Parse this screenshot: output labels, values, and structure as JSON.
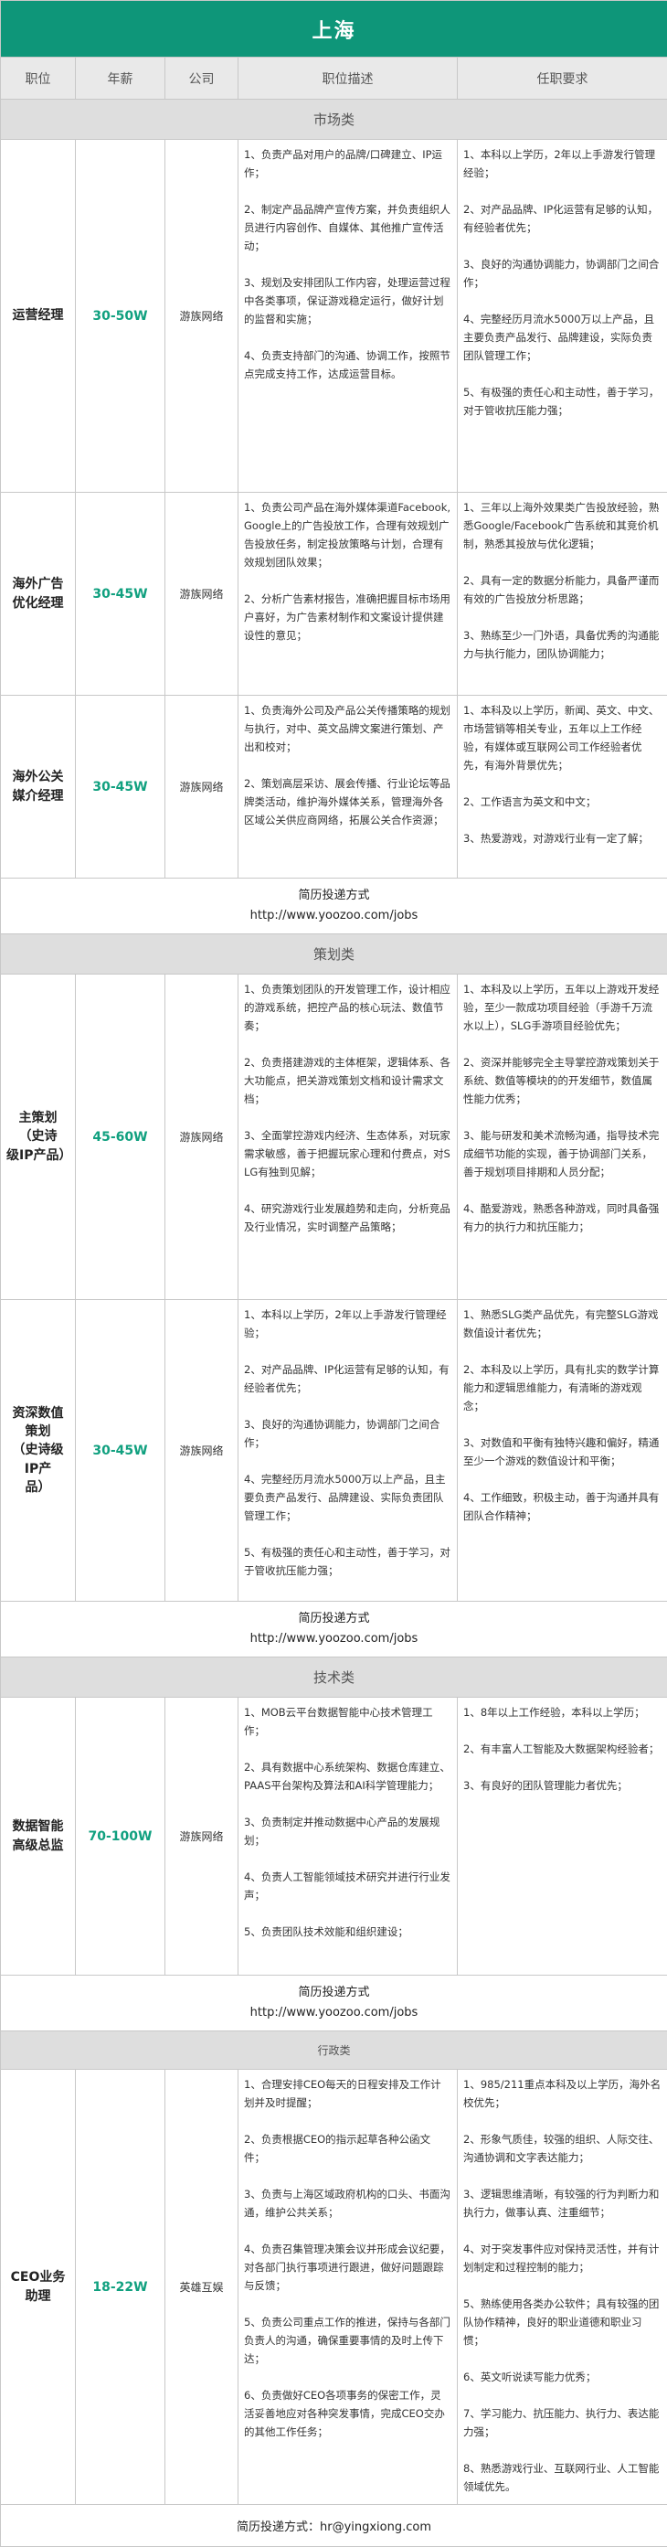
{
  "title": "上海",
  "headers": {
    "position": "职位",
    "salary": "年薪",
    "company": "公司",
    "desc": "职位描述",
    "req": "任职要求"
  },
  "sections": [
    {
      "category": "市场类",
      "jobs": [
        {
          "position": "运营经理",
          "salary": "30-50W",
          "company": "游族网络",
          "desc": "1、负责产品对用户的品牌/口碑建立、IP运作；\n\n2、制定产品品牌产宣传方案，并负责组织人员进行内容创作、自媒体、其他推广宣传活动；\n\n3、规划及安排团队工作内容，处理运营过程中各类事项，保证游戏稳定运行，做好计划的监督和实施；\n\n4、负责支持部门的沟通、协调工作，按照节点完成支持工作，达成运营目标。",
          "req": "1、本科以上学历，2年以上手游发行管理经验；\n\n2、对产品品牌、IP化运营有足够的认知，有经验者优先；\n\n3、良好的沟通协调能力，协调部门之间合作；\n\n4、完整经历月流水5000万以上产品，且主要负责产品发行、品牌建设，实际负责团队管理工作；\n\n5、有极强的责任心和主动性，善于学习，对于管收抗压能力强；"
        },
        {
          "position": "海外广告\n优化经理",
          "salary": "30-45W",
          "company": "游族网络",
          "desc": "1、负责公司产品在海外媒体渠道Facebook,Google上的广告投放工作，合理有效规划广告投放任务，制定投放策略与计划，合理有效规划团队效果；\n\n2、分析广告素材报告，准确把握目标市场用户喜好，为广告素材制作和文案设计提供建设性的意见；",
          "req": "1、三年以上海外效果类广告投放经验，熟悉Google/Facebook广告系统和其竞价机制，熟悉其投放与优化逻辑；\n\n2、具有一定的数据分析能力，具备严谨而有效的广告投放分析思路；\n\n3、熟练至少一门外语，具备优秀的沟通能力与执行能力，团队协调能力；"
        },
        {
          "position": "海外公关\n媒介经理",
          "salary": "30-45W",
          "company": "游族网络",
          "desc": "1、负责海外公司及产品公关传播策略的规划与执行，对中、英文品牌文案进行策划、产出和校对；\n\n2、策划高层采访、展会传播、行业论坛等品牌类活动，维护海外媒体关系，管理海外各区域公关供应商网络，拓展公关合作资源；",
          "req": "1、本科及以上学历，新闻、英文、中文、市场营销等相关专业，五年以上工作经验，有媒体或互联网公司工作经验者优先，有海外背景优先；\n\n2、工作语言为英文和中文；\n\n3、热爱游戏，对游戏行业有一定了解；"
        }
      ],
      "contact_label": "简历投递方式",
      "contact_url": "http://www.yoozoo.com/jobs"
    },
    {
      "category": "策划类",
      "jobs": [
        {
          "position": "主策划（史诗\n级IP产品）",
          "salary": "45-60W",
          "company": "游族网络",
          "desc": "1、负责策划团队的开发管理工作，设计相应的游戏系统，把控产品的核心玩法、数值节奏；\n\n2、负责搭建游戏的主体框架，逻辑体系、各大功能点，把关游戏策划文档和设计需求文档；\n\n3、全面掌控游戏内经济、生态体系，对玩家需求敏感，善于把握玩家心理和付费点，对SLG有独到见解；\n\n4、研究游戏行业发展趋势和走向，分析竞品及行业情况，实时调整产品策略；",
          "req": "1、本科及以上学历，五年以上游戏开发经验，至少一款成功项目经验（手游千万流水以上），SLG手游项目经验优先；\n\n2、资深并能够完全主导掌控游戏策划关于系统、数值等模块的的开发细节，数值属性能力优秀；\n\n3、能与研发和美术流畅沟通，指导技术完成细节功能的实现，善于协调部门关系，善于规划项目排期和人员分配；\n\n4、酷爱游戏，熟悉各种游戏，同时具备强有力的执行力和抗压能力；"
        },
        {
          "position": "资深数值策划\n（史诗级IP产\n品）",
          "salary": "30-45W",
          "company": "游族网络",
          "desc": "1、本科以上学历，2年以上手游发行管理经验；\n\n2、对产品品牌、IP化运营有足够的认知，有经验者优先；\n\n3、良好的沟通协调能力，协调部门之间合作；\n\n4、完整经历月流水5000万以上产品，且主要负责产品发行、品牌建设、实际负责团队管理工作；\n\n5、有极强的责任心和主动性，善于学习，对于管收抗压能力强；",
          "req": "1、熟悉SLG类产品优先，有完整SLG游戏数值设计者优先；\n\n2、本科及以上学历，具有扎实的数学计算能力和逻辑思维能力，有清晰的游戏观念；\n\n3、对数值和平衡有独特兴趣和偏好，精通至少一个游戏的数值设计和平衡；\n\n4、工作细致，积极主动，善于沟通并具有团队合作精神；"
        }
      ],
      "contact_label": "简历投递方式",
      "contact_url": "http://www.yoozoo.com/jobs"
    },
    {
      "category": "技术类",
      "jobs": [
        {
          "position": "数据智能\n高级总监",
          "salary": "70-100W",
          "company": "游族网络",
          "desc": "1、MOB云平台数据智能中心技术管理工作；\n\n2、具有数据中心系统架构、数据仓库建立、PAAS平台架构及算法和AI科学管理能力；\n\n3、负责制定并推动数据中心产品的发展规划；\n\n4、负责人工智能领域技术研究并进行行业发声；\n\n5、负责团队技术效能和组织建设；",
          "req": "1、8年以上工作经验，本科以上学历；\n\n2、有丰富人工智能及大数据架构经验者；\n\n3、有良好的团队管理能力者优先；"
        }
      ],
      "contact_label": "简历投递方式",
      "contact_url": "http://www.yoozoo.com/jobs"
    },
    {
      "category": "行政类",
      "small": true,
      "jobs": [
        {
          "position": "CEO业务助理",
          "salary": "18-22W",
          "company": "英雄互娱",
          "desc": "1、合理安排CEO每天的日程安排及工作计划并及时提醒；\n\n2、负责根据CEO的指示起草各种公函文件；\n\n3、负责与上海区域政府机构的口头、书面沟通，维护公共关系；\n\n4、负责召集管理决策会议并形成会议纪要，对各部门执行事项进行跟进，做好问题跟踪与反馈；\n\n5、负责公司重点工作的推进，保持与各部门负责人的沟通，确保重要事情的及时上传下达；\n\n6、负责做好CEO各项事务的保密工作，灵活妥善地应对各种突发事情，完成CEO交办的其他工作任务；",
          "req": "1、985/211重点本科及以上学历，海外名校优先；\n\n2、形象气质佳，较强的组织、人际交往、沟通协调和文字表达能力；\n\n3、逻辑思维清晰，有较强的行为判断力和执行力，做事认真、注重细节；\n\n4、对于突发事件应对保持灵活性，并有计划制定和过程控制的能力；\n\n5、熟练使用各类办公软件；具有较强的团队协作精神，良好的职业道德和职业习惯；\n\n6、英文听说读写能力优秀；\n\n7、学习能力、抗压能力、执行力、表达能力强；\n\n8、熟悉游戏行业、互联网行业、人工智能领域优先。"
        }
      ],
      "footer": "简历投递方式：hr@yingxiong.com"
    }
  ]
}
